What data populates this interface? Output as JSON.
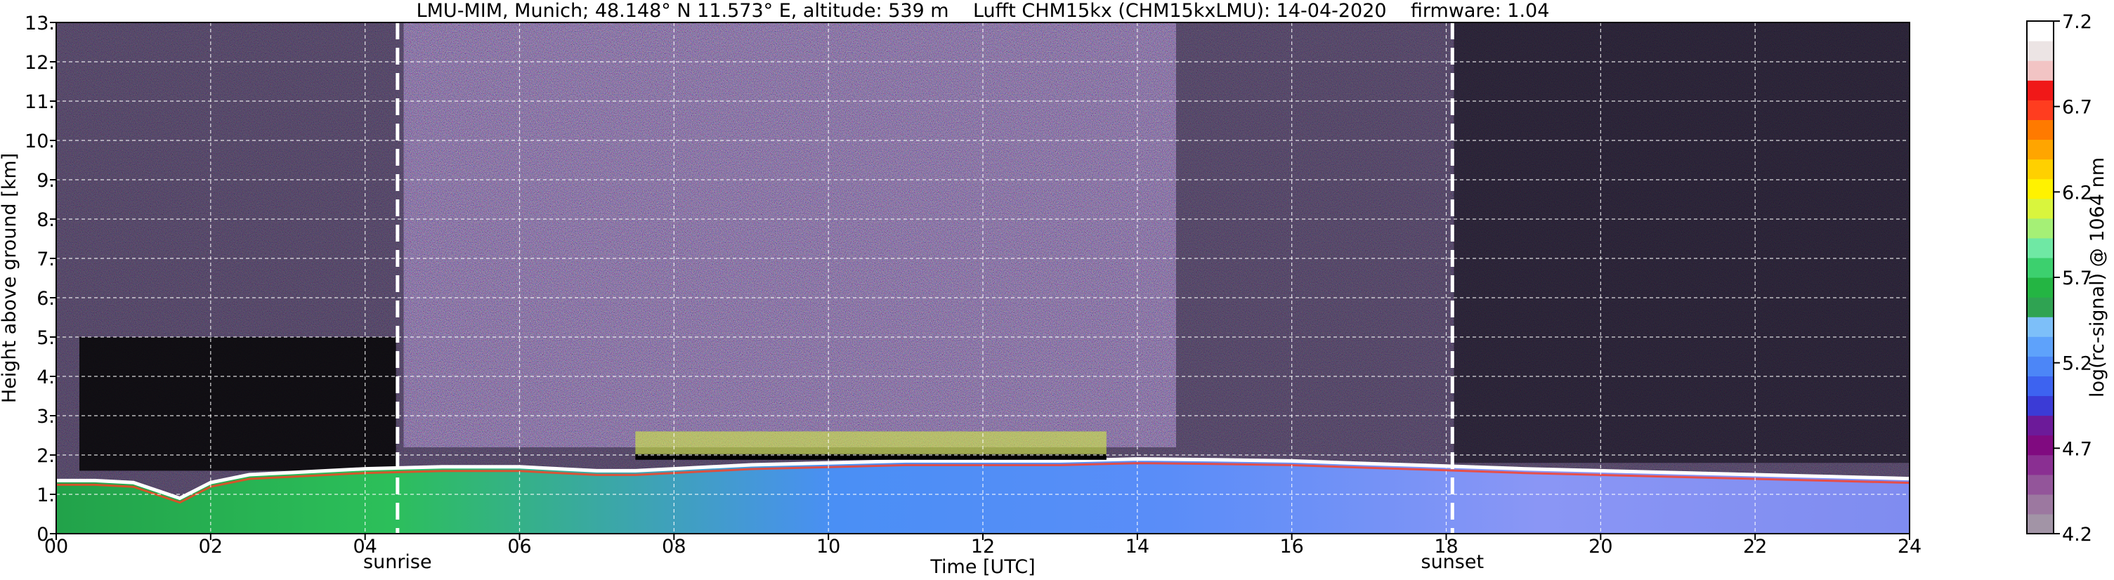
{
  "chart_data": {
    "type": "heatmap",
    "title": "LMU-MIM, Munich; 48.148° N 11.573° E, altitude: 539 m    Lufft CHM15kx (CHM15kxLMU): 14-04-2020    firmware: 1.04",
    "xlabel": "Time [UTC]",
    "ylabel": "Height above ground [km]",
    "xlim": [
      0,
      24
    ],
    "ylim": [
      0,
      13
    ],
    "x_ticks": [
      "00",
      "02",
      "04",
      "06",
      "08",
      "10",
      "12",
      "14",
      "16",
      "18",
      "20",
      "22",
      "24"
    ],
    "x_tick_values": [
      0,
      2,
      4,
      6,
      8,
      10,
      12,
      14,
      16,
      18,
      20,
      22,
      24
    ],
    "y_ticks": [
      "0.",
      "1.",
      "2.",
      "3.",
      "4.",
      "5.",
      "6.",
      "7.",
      "8.",
      "9.",
      "10.",
      "11.",
      "12.",
      "13."
    ],
    "y_tick_values": [
      0,
      1,
      2,
      3,
      4,
      5,
      6,
      7,
      8,
      9,
      10,
      11,
      12,
      13
    ],
    "grid": true,
    "colorbar": {
      "label": "log(rc-signal) @ 1064 nm",
      "min": 4.2,
      "max": 7.2,
      "ticks": [
        "4.2",
        "4.7",
        "5.2",
        "5.7",
        "6.2",
        "6.7",
        "7.2"
      ],
      "tick_values": [
        4.2,
        4.7,
        5.2,
        5.7,
        6.2,
        6.7,
        7.2
      ],
      "colors": [
        "#a294a6",
        "#9c78a0",
        "#93559a",
        "#8a2f92",
        "#800a80",
        "#6c1a99",
        "#3b3bd6",
        "#3d63f0",
        "#4c86f7",
        "#5ea2fb",
        "#7dbff9",
        "#2fa352",
        "#24b543",
        "#3cd06e",
        "#6fe8a4",
        "#a5f076",
        "#d9f53d",
        "#fff200",
        "#ffd000",
        "#ffa500",
        "#ff7a00",
        "#ff3d1f",
        "#f01818",
        "#f2c4c4",
        "#ece4e4",
        "#ffffff"
      ]
    },
    "annotations": [
      {
        "label": "sunrise",
        "x": 4.42
      },
      {
        "label": "sunset",
        "x": 18.08
      }
    ],
    "features": {
      "boundary_layer_top_km": {
        "x": [
          0,
          0.5,
          1.0,
          1.3,
          1.6,
          2.0,
          2.5,
          3.0,
          4.0,
          5.0,
          6.0,
          7.0,
          7.5,
          8.0,
          9.0,
          10.0,
          11.0,
          12.0,
          13.0,
          14.0,
          15.0,
          16.0,
          17.0,
          18.0,
          19.0,
          20.0,
          21.0,
          22.0,
          23.0,
          24.0
        ],
        "y": [
          1.35,
          1.35,
          1.3,
          1.1,
          0.9,
          1.3,
          1.5,
          1.55,
          1.65,
          1.7,
          1.7,
          1.6,
          1.6,
          1.65,
          1.75,
          1.8,
          1.85,
          1.85,
          1.85,
          1.9,
          1.88,
          1.85,
          1.78,
          1.72,
          1.65,
          1.6,
          1.55,
          1.5,
          1.45,
          1.4
        ]
      },
      "cloud_layer": {
        "x_start": 7.5,
        "x_end": 13.6,
        "base_km": 1.95,
        "top_km": 2.6
      },
      "noisy_upper_troposphere": {
        "x_start": 4.5,
        "x_end": 14.5
      }
    }
  }
}
